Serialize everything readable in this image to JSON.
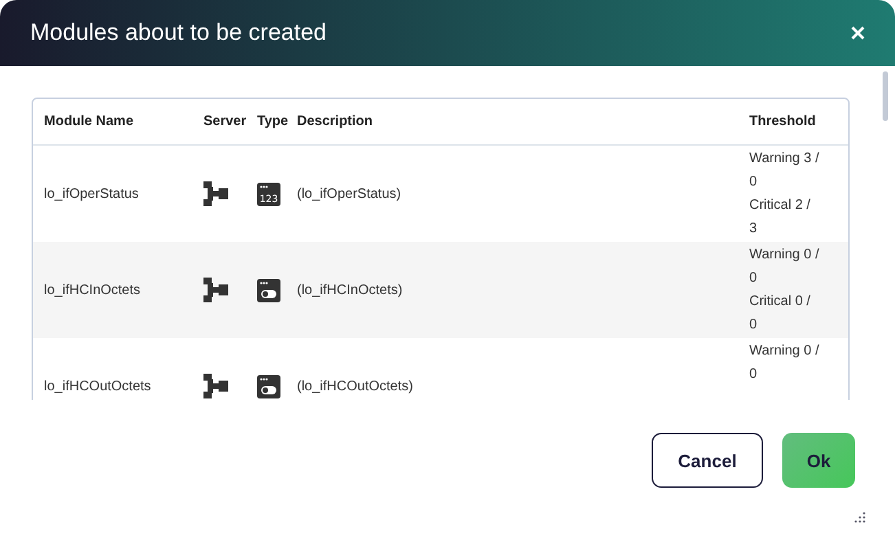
{
  "dialog": {
    "title": "Modules about to be created"
  },
  "table": {
    "columns": [
      "Module Name",
      "Server",
      "Type",
      "Description",
      "Threshold"
    ],
    "rows": [
      {
        "name": "lo_ifOperStatus",
        "kind": "numeric",
        "type_icon_label": "123",
        "description": "(lo_ifOperStatus)",
        "warning": "Warning 3 / 0",
        "critical": "Critical 2 / 3"
      },
      {
        "name": "lo_ifHCInOctets",
        "kind": "boolean",
        "description": "(lo_ifHCInOctets)",
        "warning": "Warning 0 / 0",
        "critical": "Critical 0 / 0"
      },
      {
        "name": "lo_ifHCOutOctets",
        "kind": "boolean",
        "description": "(lo_ifHCOutOctets)",
        "warning": "Warning 0 / 0"
      }
    ]
  },
  "buttons": {
    "cancel": "Cancel",
    "ok": "Ok"
  }
}
